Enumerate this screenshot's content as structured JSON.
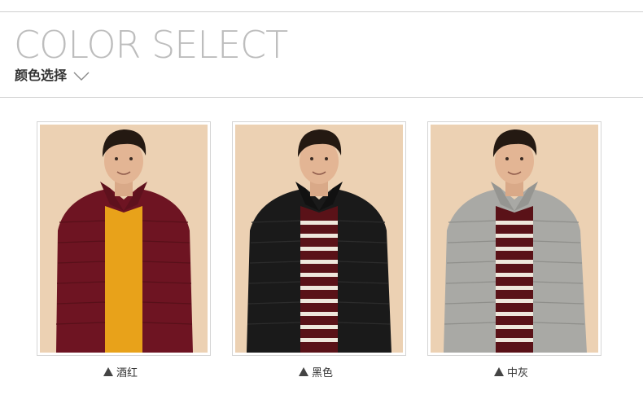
{
  "header": {
    "title": "COLOR SELECT",
    "subtitle": "颜色选择",
    "chevron_icon": "chevron-down-icon"
  },
  "colors": [
    {
      "label": "酒红",
      "marker_icon": "triangle-up-icon",
      "jacket_color": "#6e1422",
      "inner_color": "#e8a21a"
    },
    {
      "label": "黑色",
      "marker_icon": "triangle-up-icon",
      "jacket_color": "#1a1a1a",
      "inner_color": "#5a1218"
    },
    {
      "label": "中灰",
      "marker_icon": "triangle-up-icon",
      "jacket_color": "#a9a9a5",
      "inner_color": "#5a1218"
    }
  ]
}
